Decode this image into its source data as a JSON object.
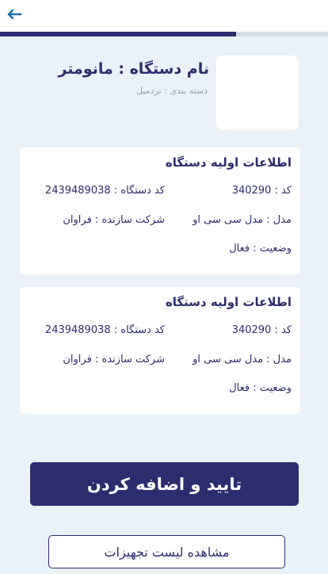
{
  "nav": {
    "back_icon": "arrow-left-icon"
  },
  "progress": {
    "value_percent": 72
  },
  "device": {
    "name": "نام دستگاه : مانومتر",
    "category": "دسته بندی : تردمیل"
  },
  "cards": [
    {
      "title": "اطلاعات اولیه دستگاه",
      "code": "کد : 340290",
      "device_code": "کد دستگاه : 2439489038",
      "model": "مدل : مدل سی سی او",
      "manufacturer": "شرکت سازنده : فراوان",
      "status": "وضعیت : فعال"
    },
    {
      "title": "اطلاعات اولیه دستگاه",
      "code": "کد : 340290",
      "device_code": "کد دستگاه : 2439489038",
      "model": "مدل : مدل سی سی او",
      "manufacturer": "شرکت سازنده : فراوان",
      "status": "وضعیت : فعال"
    }
  ],
  "actions": {
    "confirm_label": "تایید و اضافه کردن",
    "view_list_label": "مشاهده لیست تجهیزات"
  },
  "colors": {
    "primary": "#2b2d6e",
    "background": "#eaf1f8",
    "back_arrow": "#1f6fa8"
  }
}
